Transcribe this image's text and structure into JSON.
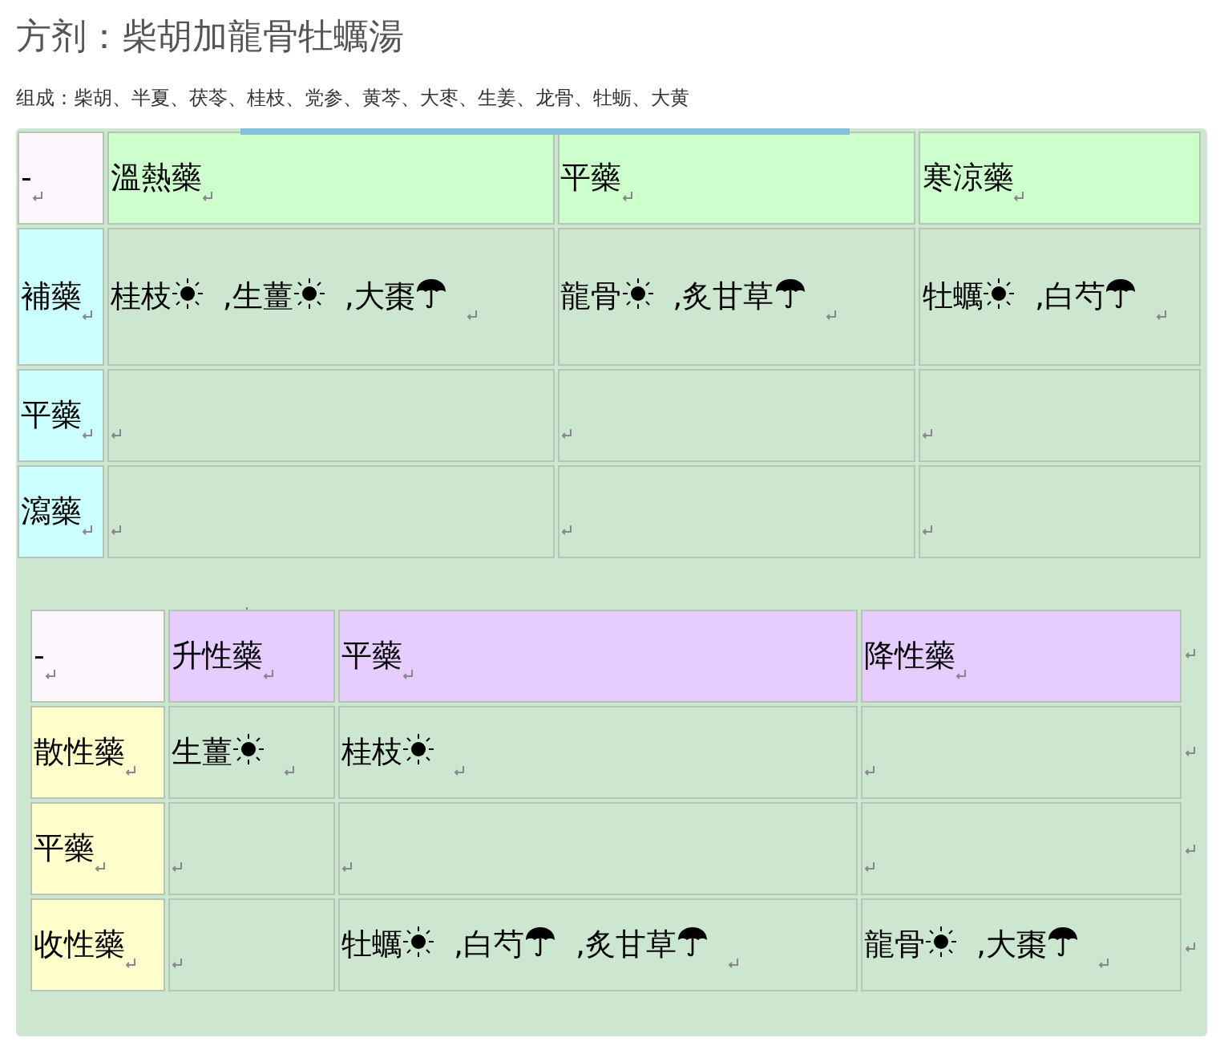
{
  "title": "方剂：柴胡加龍骨牡蠣湯",
  "composition": "组成：柴胡、半夏、茯苓、桂枝、党参、黄芩、大枣、生姜、龙骨、牡蛎、大黄",
  "tables": [
    {
      "corner": "-",
      "columns": [
        "溫熱藥",
        "平藥",
        "寒涼藥"
      ],
      "rows": [
        {
          "label": "補藥",
          "cells": [
            [
              {
                "text": "桂枝",
                "kind": "sun"
              },
              {
                "text": ",生薑",
                "kind": "sun"
              },
              {
                "text": ",大棗",
                "kind": "umbrella"
              }
            ],
            [
              {
                "text": "龍骨",
                "kind": "sun"
              },
              {
                "text": ",炙甘草",
                "kind": "umbrella"
              }
            ],
            [
              {
                "text": "牡蠣",
                "kind": "sun"
              },
              {
                "text": ",白芍",
                "kind": "umbrella"
              }
            ]
          ]
        },
        {
          "label": "平藥",
          "cells": [
            [],
            [],
            []
          ]
        },
        {
          "label": "瀉藥",
          "cells": [
            [],
            [],
            []
          ]
        }
      ]
    },
    {
      "corner": "-",
      "columns": [
        "升性藥",
        "平藥",
        "降性藥"
      ],
      "rows": [
        {
          "label": "散性藥",
          "cells": [
            [
              {
                "text": "生薑",
                "kind": "sun"
              }
            ],
            [
              {
                "text": "桂枝",
                "kind": "sun"
              }
            ],
            []
          ]
        },
        {
          "label": "平藥",
          "cells": [
            [],
            [],
            []
          ]
        },
        {
          "label": "收性藥",
          "cells": [
            [],
            [
              {
                "text": "牡蠣",
                "kind": "sun"
              },
              {
                "text": ",白芍",
                "kind": "umbrella"
              },
              {
                "text": ",炙甘草",
                "kind": "umbrella"
              }
            ],
            [
              {
                "text": "龍骨",
                "kind": "sun"
              },
              {
                "text": ",大棗",
                "kind": "umbrella"
              }
            ]
          ]
        }
      ]
    }
  ]
}
